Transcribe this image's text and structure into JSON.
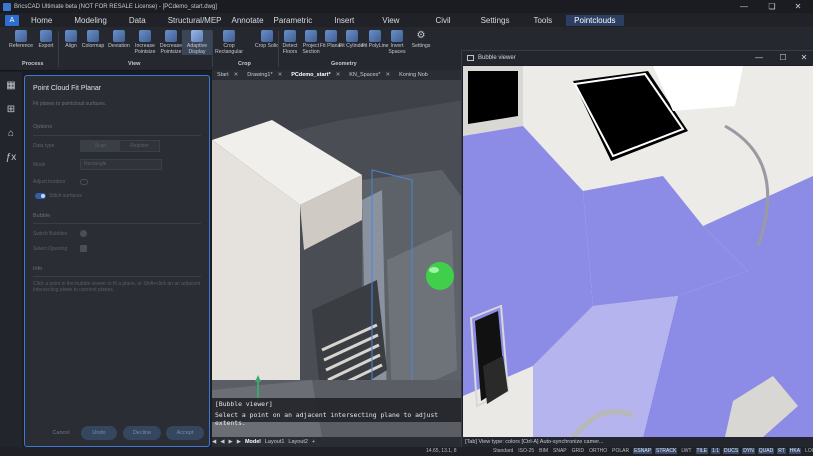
{
  "window": {
    "title": "BricsCAD Ultimate beta (NOT FOR RESALE License) - [PCdemo_start.dwg]",
    "minimize": "—",
    "restore": "❏",
    "close": "✕"
  },
  "app_button": "A",
  "menu": [
    "Home",
    "Modeling",
    "Data",
    "Structural/MEP",
    "Annotate",
    "Parametric",
    "Insert",
    "View",
    "Civil",
    "Settings",
    "Tools",
    "Pointclouds"
  ],
  "menu_active": "Pointclouds",
  "ribbon": {
    "process": {
      "label": "Process",
      "buttons": [
        "Reference",
        "Export"
      ]
    },
    "view": {
      "label": "View",
      "buttons": [
        "Align",
        "Colormap",
        "Deviation",
        "Increase Pointsize",
        "Decrease Pointsize",
        "Adaptive Display"
      ]
    },
    "crop": {
      "label": "Crop",
      "buttons": [
        "Crop Rectangular",
        "Crop Solid"
      ]
    },
    "geometry": {
      "label": "Geometry",
      "buttons": [
        "Detect Floors",
        "Project Section",
        "Fit Planar",
        "Fit Cylinder",
        "Fit PolyLine",
        "Invert Spaces"
      ]
    },
    "settings": "Settings"
  },
  "rail_icons": [
    "layers-icon",
    "structure-icon",
    "home-icon",
    "function-icon"
  ],
  "rail_glyphs": [
    "▦",
    "⊞",
    "⌂",
    "ƒx"
  ],
  "panel": {
    "title": "Point Cloud Fit Planar",
    "description": "Fit planes to pointcloud surfaces.",
    "options_label": "Options",
    "data_type_label": "Data type",
    "data_type_options": [
      "Scan",
      "Register"
    ],
    "mode_label": "Mode",
    "mode_value": "Rectangle",
    "adjust_borders_label": "Adjust borders",
    "stitch_surfaces_label": "Stitch surfaces",
    "bubble_label": "Bubble",
    "switch_bubbles_label": "Switch Bubbles",
    "select_opening_label": "Select Opening",
    "info_label": "Info",
    "info_text": "Click a point in the bubble viewer to fit a plane, or Shift+click an an adjacent intersecting plane to connect planes.",
    "buttons": {
      "cancel": "Cancel",
      "undo": "Undo",
      "decline": "Decline",
      "accept": "Accept"
    }
  },
  "doc_tabs": [
    "Start",
    "Drawing1*",
    "PCdemo_start*",
    "KN_Spaces*",
    "Koning Nob"
  ],
  "doc_tab_active": "PCdemo_start*",
  "command": {
    "line1": "[Bubble viewer]",
    "line2": "Select a point on an adjacent intersecting plane to adjust extents."
  },
  "layout_tabs": [
    "Model",
    "Layout1",
    "Layout2",
    "+"
  ],
  "layout_active": "Model",
  "layout_nav": [
    "◀",
    "◀",
    "▶",
    "▶"
  ],
  "bubble_viewer": {
    "title": "Bubble viewer",
    "status": "[Tab] View type: colors     [Ctrl-A] Auto-synchronize camer...",
    "wall_color": "#8c8ce6"
  },
  "status": {
    "coords": "14.65, 13.1, 8",
    "items": [
      "Standard",
      "ISO-25",
      "BIM",
      "SNAP",
      "GRID",
      "ORTHO",
      "POLAR",
      "ESNAP",
      "STRACK",
      "LWT",
      "TILE",
      "1:1",
      "DUCS",
      "DYN",
      "QUAD",
      "RT",
      "HKA",
      "LOCKUI",
      "None"
    ],
    "active_items": [
      "ESNAP",
      "STRACK",
      "TILE",
      "1:1",
      "DUCS",
      "DYN",
      "QUAD",
      "RT",
      "HKA"
    ]
  }
}
